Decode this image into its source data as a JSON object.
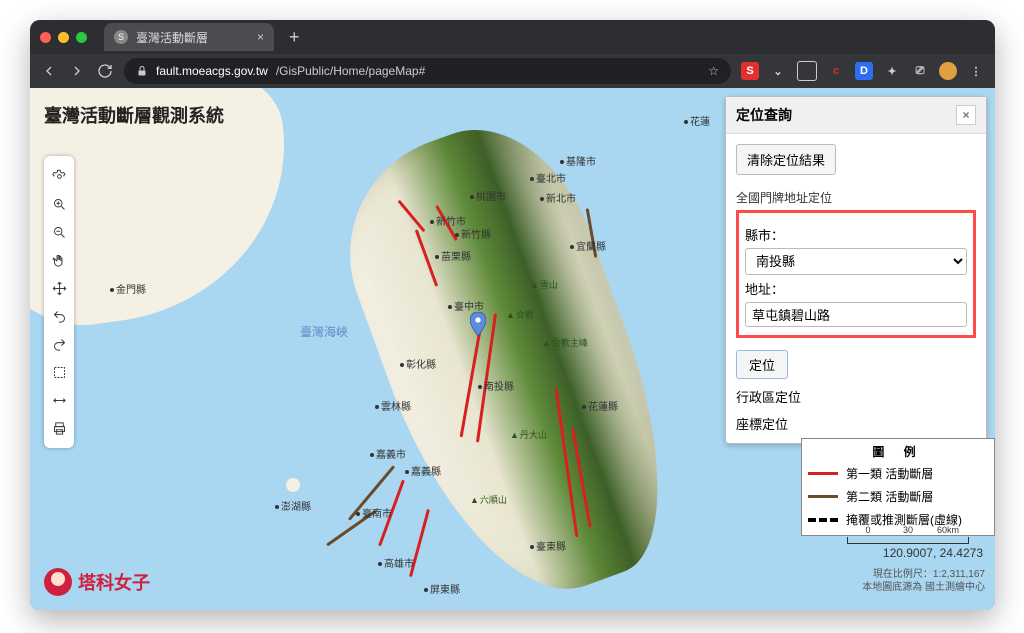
{
  "browser": {
    "tab_title": "臺灣活動斷層",
    "url_host": "fault.moeacgs.gov.tw",
    "url_path": "/GisPublic/Home/pageMap#"
  },
  "page_title": "臺灣活動斷層觀測系統",
  "panel": {
    "title": "定位查詢",
    "clear_btn": "清除定位結果",
    "section_label": "全國門牌地址定位",
    "county_label": "縣市：",
    "county_value": "南投縣",
    "address_label": "地址：",
    "address_value": "草屯鎮碧山路",
    "locate_btn": "定位",
    "link_district": "行政區定位",
    "link_coord": "座標定位"
  },
  "legend": {
    "title": "圖 例",
    "row1": "第一類 活動斷層",
    "row2": "第二類 活動斷層",
    "row3": "掩覆或推測斷層(虛線)"
  },
  "scale": {
    "t0": "0",
    "t1": "30",
    "t2": "60km"
  },
  "coords": "120.9007, 24.4273",
  "attrib_line1": "現在比例尺：1:2,311,167",
  "attrib_line2": "本地圖底源為 國土測繪中心",
  "strait": "臺灣海峽",
  "cities": {
    "kinmen": "金門縣",
    "penghu": "澎湖縣",
    "keelung": "基隆市",
    "taipei": "臺北市",
    "newtaipei": "新北市",
    "taoyuan": "桃園市",
    "hsinchu": "新竹市",
    "hsinchuco": "新竹縣",
    "miaoli": "苗栗縣",
    "yilan": "宜蘭縣",
    "taichung": "臺中市",
    "changhua": "彰化縣",
    "nantou": "南投縣",
    "yunlin": "雲林縣",
    "chiayi": "嘉義市",
    "chiayico": "嘉義縣",
    "tainan": "臺南市",
    "kaohsiung": "高雄市",
    "pingtung": "屏東縣",
    "hualien": "花蓮縣",
    "taitung": "臺東縣",
    "hualien_t": "花蓮"
  },
  "mountains": {
    "m1": "雪山",
    "m2": "合歡",
    "m3": "合歡主峰",
    "m4": "丹大山",
    "m5": "六順山"
  },
  "watermark": "塔科女子"
}
